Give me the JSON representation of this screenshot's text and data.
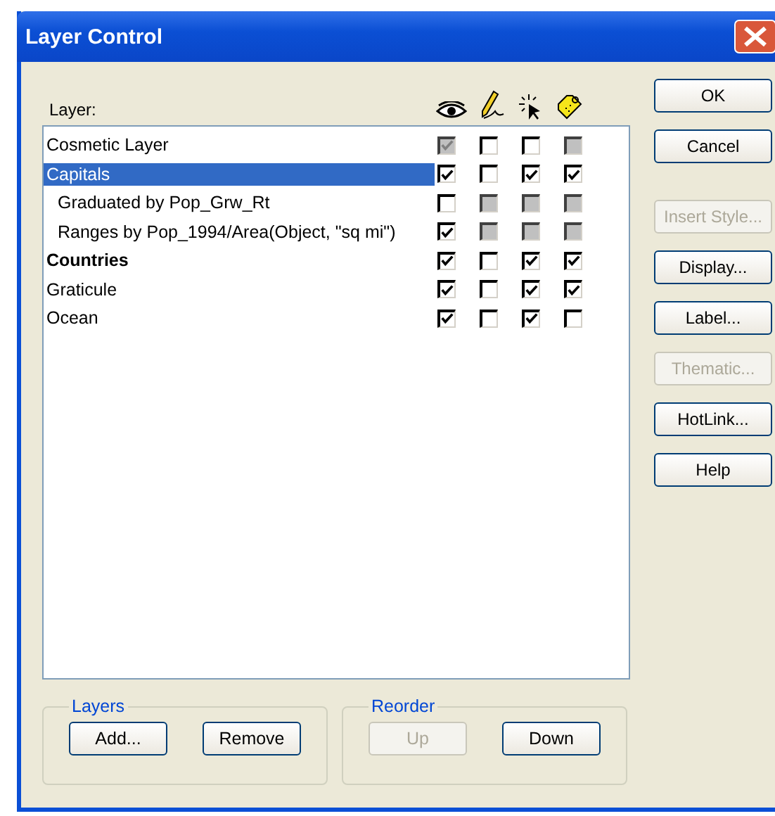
{
  "window": {
    "title": "Layer Control"
  },
  "list_label": "Layer:",
  "layers": [
    {
      "name": "Cosmetic Layer",
      "selected": false,
      "bold": false,
      "checks": [
        {
          "checked": true,
          "disabled": true
        },
        {
          "checked": false,
          "disabled": false
        },
        {
          "checked": false,
          "disabled": false
        },
        {
          "checked": false,
          "disabled": true
        }
      ]
    },
    {
      "name": "Capitals",
      "selected": true,
      "bold": false,
      "checks": [
        {
          "checked": true,
          "disabled": false
        },
        {
          "checked": false,
          "disabled": false
        },
        {
          "checked": true,
          "disabled": false
        },
        {
          "checked": true,
          "disabled": false
        }
      ],
      "children": [
        {
          "name": "Graduated by Pop_Grw_Rt",
          "selected": false,
          "bold": false,
          "checks": [
            {
              "checked": false,
              "disabled": false
            },
            {
              "checked": false,
              "disabled": true
            },
            {
              "checked": false,
              "disabled": true
            },
            {
              "checked": false,
              "disabled": true
            }
          ]
        },
        {
          "name": "Ranges by Pop_1994/Area(Object, \"sq mi\")",
          "selected": false,
          "bold": false,
          "checks": [
            {
              "checked": true,
              "disabled": false
            },
            {
              "checked": false,
              "disabled": true
            },
            {
              "checked": false,
              "disabled": true
            },
            {
              "checked": false,
              "disabled": true
            }
          ]
        }
      ]
    },
    {
      "name": "Countries",
      "selected": false,
      "bold": true,
      "checks": [
        {
          "checked": true,
          "disabled": false
        },
        {
          "checked": false,
          "disabled": false
        },
        {
          "checked": true,
          "disabled": false
        },
        {
          "checked": true,
          "disabled": false
        }
      ]
    },
    {
      "name": "Graticule",
      "selected": false,
      "bold": false,
      "checks": [
        {
          "checked": true,
          "disabled": false
        },
        {
          "checked": false,
          "disabled": false
        },
        {
          "checked": true,
          "disabled": false
        },
        {
          "checked": true,
          "disabled": false
        }
      ]
    },
    {
      "name": "Ocean",
      "selected": false,
      "bold": false,
      "checks": [
        {
          "checked": true,
          "disabled": false
        },
        {
          "checked": false,
          "disabled": false
        },
        {
          "checked": true,
          "disabled": false
        },
        {
          "checked": false,
          "disabled": false
        }
      ]
    }
  ],
  "side_buttons": [
    {
      "label": "OK",
      "disabled": false
    },
    {
      "label": "Cancel",
      "disabled": false
    },
    {
      "label": "Insert Style...",
      "disabled": true
    },
    {
      "label": "Display...",
      "disabled": false
    },
    {
      "label": "Label...",
      "disabled": false
    },
    {
      "label": "Thematic...",
      "disabled": true
    },
    {
      "label": "HotLink...",
      "disabled": false
    },
    {
      "label": "Help",
      "disabled": false
    }
  ],
  "groups": [
    {
      "title": "Layers",
      "buttons": [
        {
          "label": "Add...",
          "disabled": false
        },
        {
          "label": "Remove",
          "disabled": false
        }
      ]
    },
    {
      "title": "Reorder",
      "buttons": [
        {
          "label": "Up",
          "disabled": true
        },
        {
          "label": "Down",
          "disabled": false
        }
      ]
    }
  ]
}
